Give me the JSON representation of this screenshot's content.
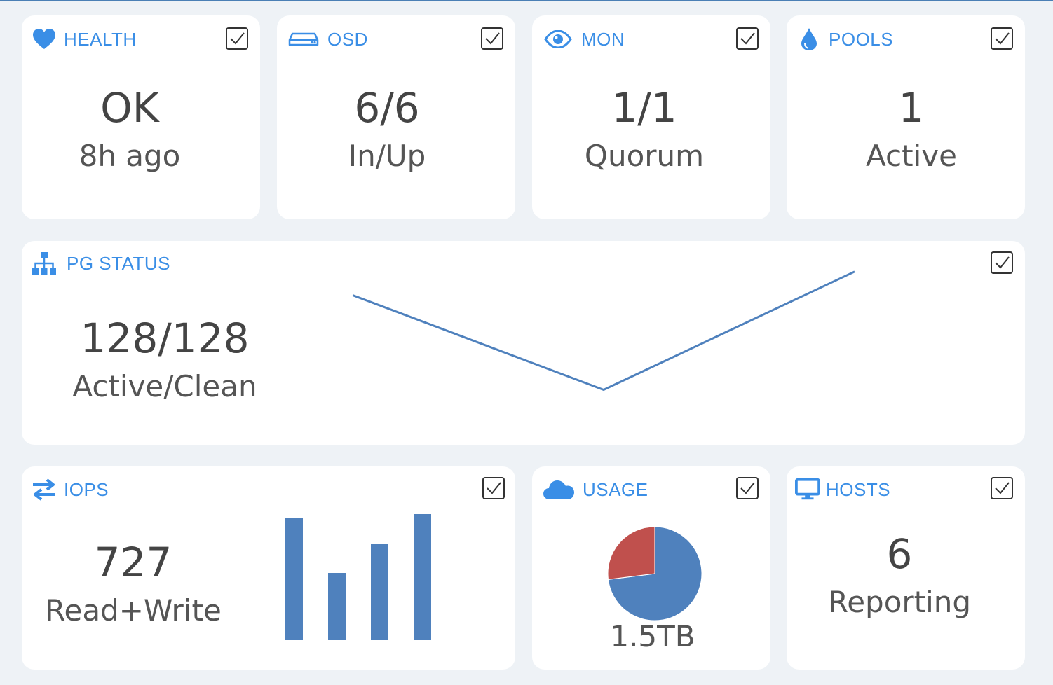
{
  "cards": {
    "health": {
      "title": "HEALTH",
      "value": "OK",
      "sub": "8h ago"
    },
    "osd": {
      "title": "OSD",
      "value": "6/6",
      "sub": "In/Up"
    },
    "mon": {
      "title": "MON",
      "value": "1/1",
      "sub": "Quorum"
    },
    "pools": {
      "title": "POOLS",
      "value": "1",
      "sub": "Active"
    },
    "pg": {
      "title": "PG STATUS",
      "value": "128/128",
      "sub": "Active/Clean"
    },
    "iops": {
      "title": "IOPS",
      "value": "727",
      "sub": "Read+Write"
    },
    "usage": {
      "title": "USAGE",
      "value": "1.5TB"
    },
    "hosts": {
      "title": "HOSTS",
      "value": "6",
      "sub": "Reporting"
    }
  },
  "colors": {
    "accent": "#3a8ee6",
    "chart_blue": "#4f81bd",
    "chart_red": "#c0504d",
    "background": "#eef2f6"
  },
  "icons": {
    "health": "heart-icon",
    "osd": "disk-drive-icon",
    "mon": "eye-icon",
    "pools": "droplet-icon",
    "pg": "sitemap-icon",
    "iops": "exchange-arrows-icon",
    "usage": "cloud-icon",
    "hosts": "monitor-icon",
    "card_action": "checkbox-icon"
  },
  "chart_data": [
    {
      "type": "line",
      "x": [
        1,
        2,
        3
      ],
      "series": [
        {
          "values": [
            3,
            1,
            3.5
          ]
        }
      ],
      "ylim": [
        0,
        4
      ],
      "grid": false,
      "legend": "none"
    },
    {
      "type": "bar",
      "categories": [
        "1",
        "2",
        "3",
        "4"
      ],
      "values": [
        5.8,
        3.2,
        4.6,
        6.0
      ],
      "ylim": [
        0,
        6
      ],
      "grid": false,
      "legend": "none"
    },
    {
      "type": "pie",
      "series": [
        {
          "values": [
            73,
            27
          ]
        }
      ],
      "legend": "none"
    }
  ]
}
